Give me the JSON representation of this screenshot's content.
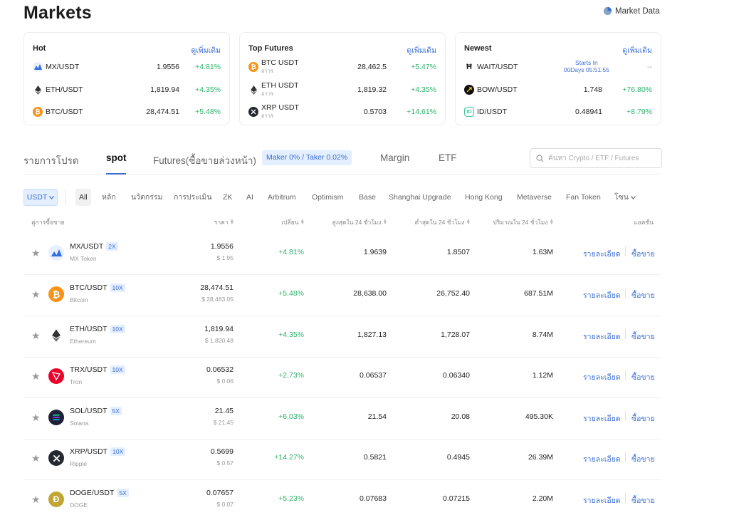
{
  "header": {
    "title": "Markets",
    "market_data_label": "Market Data"
  },
  "cards": {
    "hot": {
      "title": "Hot",
      "more": "ดูเพิ่มเติม",
      "rows": [
        {
          "pair": "MX/USDT",
          "price": "1.9556",
          "change": "+4.81%"
        },
        {
          "pair": "ETH/USDT",
          "price": "1,819.94",
          "change": "+4.35%"
        },
        {
          "pair": "BTC/USDT",
          "price": "28,474.51",
          "change": "+5.48%"
        }
      ]
    },
    "futures": {
      "title": "Top Futures",
      "more": "ดูเพิ่มเติม",
      "rows": [
        {
          "pair": "BTC USDT",
          "sub": "ถาวร",
          "price": "28,462.5",
          "change": "+5.47%"
        },
        {
          "pair": "ETH USDT",
          "sub": "ถาวร",
          "price": "1,819.32",
          "change": "+4.35%"
        },
        {
          "pair": "XRP USDT",
          "sub": "ถาวร",
          "price": "0.5703",
          "change": "+14.61%"
        }
      ]
    },
    "newest": {
      "title": "Newest",
      "more": "ดูเพิ่มเติม",
      "rows": [
        {
          "pair": "WAIT/USDT",
          "starts_label": "Starts In",
          "starts_value": "00Days 05:51:55",
          "change": "--"
        },
        {
          "pair": "BOW/USDT",
          "price": "1.748",
          "change": "+76.80%"
        },
        {
          "pair": "ID/USDT",
          "price": "0.48941",
          "change": "+8.79%"
        }
      ]
    }
  },
  "tabs": {
    "favorites": "รายการโปรด",
    "spot": "spot",
    "futures": "Futures(ซื้อขายล่วงหน้า)",
    "fee_badge": "Maker 0% / Taker 0.02%",
    "margin": "Margin",
    "etf": "ETF"
  },
  "search": {
    "placeholder": "ค้นหา Crypto / ETF / Futures"
  },
  "filters": {
    "quote": "USDT",
    "items": [
      "All",
      "หลัก",
      "นวัตกรรม",
      "การประเมิน",
      "ZK",
      "AI",
      "Arbitrum",
      "Optimism",
      "Base",
      "Shanghai Upgrade",
      "Hong Kong",
      "Metaverse",
      "Fan Token",
      "โซน"
    ]
  },
  "table": {
    "headers": {
      "pair": "คู่การซื้อขาย",
      "price": "ราคา",
      "change": "เปลี่ยน",
      "high": "สูงสุดใน 24 ชั่วโมง",
      "low": "ต่ำสุดใน 24 ชั่วโมง",
      "volume": "ปริมาณใน 24 ชั่วโมง",
      "actions": "แอคชั่น"
    },
    "actions": {
      "detail": "รายละเอียด",
      "trade": "ซื้อขาย"
    },
    "rows": [
      {
        "pair": "MX/USDT",
        "leverage": "2X",
        "name": "MX Token",
        "price": "1.9556",
        "usd": "$ 1.95",
        "change": "+4.81%",
        "high": "1.9639",
        "low": "1.8507",
        "volume": "1.63M"
      },
      {
        "pair": "BTC/USDT",
        "leverage": "10X",
        "name": "Bitcoin",
        "price": "28,474.51",
        "usd": "$ 28,483.05",
        "change": "+5.48%",
        "high": "28,638.00",
        "low": "26,752.40",
        "volume": "687.51M"
      },
      {
        "pair": "ETH/USDT",
        "leverage": "10X",
        "name": "Ethereum",
        "price": "1,819.94",
        "usd": "$ 1,820.48",
        "change": "+4.35%",
        "high": "1,827.13",
        "low": "1,728.07",
        "volume": "8.74M"
      },
      {
        "pair": "TRX/USDT",
        "leverage": "10X",
        "name": "Tron",
        "price": "0.06532",
        "usd": "$ 0.06",
        "change": "+2.73%",
        "high": "0.06537",
        "low": "0.06340",
        "volume": "1.12M"
      },
      {
        "pair": "SOL/USDT",
        "leverage": "5X",
        "name": "Solana",
        "price": "21.45",
        "usd": "$ 21.45",
        "change": "+6.03%",
        "high": "21.54",
        "low": "20.08",
        "volume": "495.30K"
      },
      {
        "pair": "XRP/USDT",
        "leverage": "10X",
        "name": "Ripple",
        "price": "0.5699",
        "usd": "$ 0.57",
        "change": "+14.27%",
        "high": "0.5821",
        "low": "0.4945",
        "volume": "26.39M"
      },
      {
        "pair": "DOGE/USDT",
        "leverage": "5X",
        "name": "DOGE",
        "price": "0.07657",
        "usd": "$ 0.07",
        "change": "+5.23%",
        "high": "0.07683",
        "low": "0.07215",
        "volume": "2.20M"
      }
    ]
  },
  "colors": {
    "accent": "#3b6fd4",
    "up": "#2fb36d",
    "badge_bg": "#e3eeff"
  }
}
